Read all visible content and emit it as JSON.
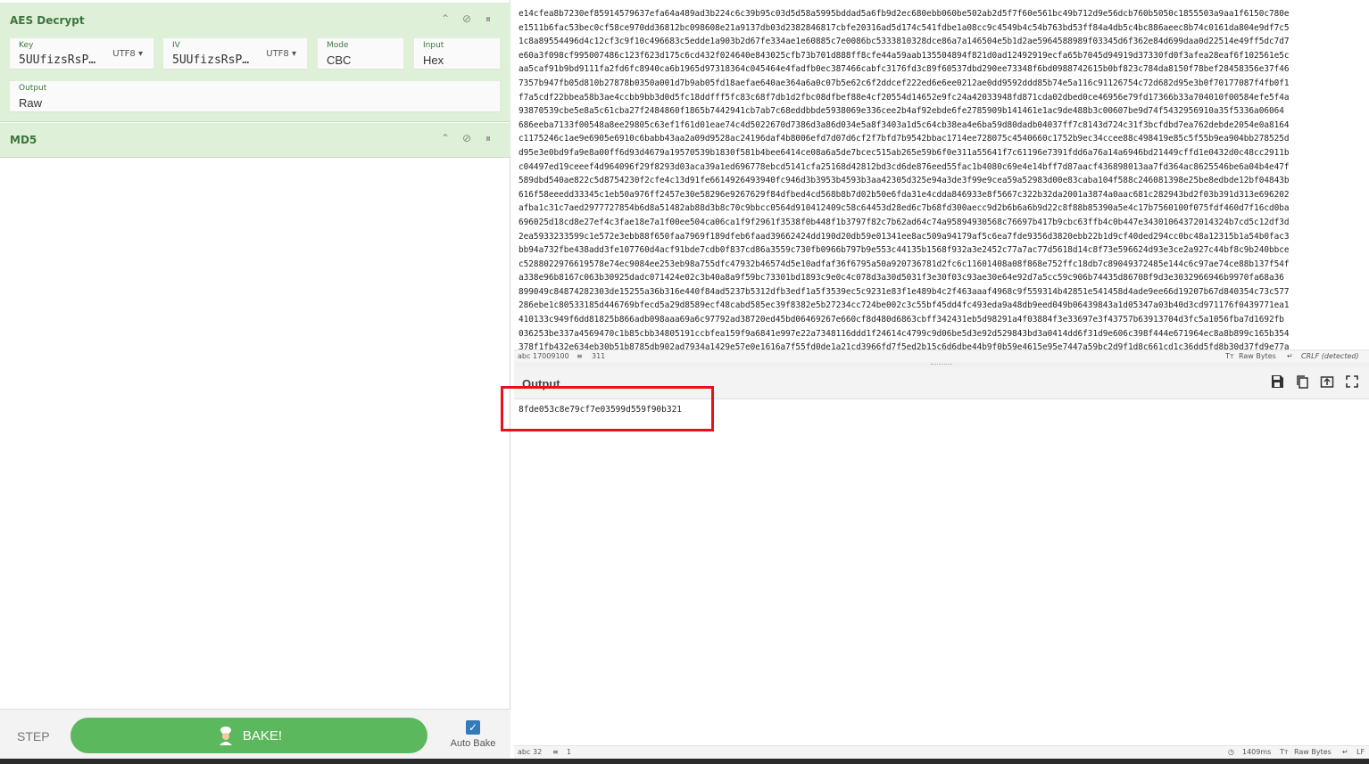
{
  "recipe": {
    "aes": {
      "title": "AES Decrypt",
      "key_label": "Key",
      "key_value": "5UUfizsRsP…",
      "key_encoding": "UTF8",
      "iv_label": "IV",
      "iv_value": "5UUfizsRsP…",
      "iv_encoding": "UTF8",
      "mode_label": "Mode",
      "mode_value": "CBC",
      "input_label": "Input",
      "input_value": "Hex",
      "output_label": "Output",
      "output_value": "Raw"
    },
    "md5": {
      "title": "MD5"
    },
    "controls": {
      "step": "STEP",
      "bake": "BAKE!",
      "auto_bake": "Auto Bake"
    }
  },
  "input": {
    "lines": [
      "e14cfea8b7230ef85914579637efa64a489ad3b224c6c39b95c03d5d58a5995bddad5a6fb9d2ec680ebb060be502ab2d5f7f60e561bc49b712d9e56dcb760b5050c1855503a9aa1f6150c780e",
      "e1511b6fac53bec0cf58ce970dd36812bc098608e21a9137db03d2382846817cbfe20316ad5d174c541fdbe1a08cc9c4549b4c54b763bd53ff84a4db5c4bc886aeec8b74c0161da804e9df7c5",
      "1c8a89554496d4c12cf3c9f10c496683c5edde1a903b2d67fe334ae1e60885c7e0086bc5333810328dce86a7a146504e5b1d2ae5964588989f03345d6f362e84d699daa0d22514e49ff5dc7d7",
      "e60a3f098cf995007486c123f623d175c6cd432f024640e843025cfb73b701d888ff8cfe44a59aab135504894f821d0ad12492919ecfa65b7045d94919d37330fd0f3afea28eaf6f102561e5c",
      "aa5caf91b9bd9111fa2fd6fc8940ca6b1965d97318364c045464e4fadfb0ec387466cabfc3176fd3c89f60537dbd290ee73348f6bd0988742615b0bf823c784da8150f78bef28458356e37f46",
      "7357b947fb05d810b27878b0350a001d7b9ab05fd18aefae640ae364a6a0c07b5e62c6f2ddcef222ed6e6ee0212ae0dd9592ddd85b74e5a116c91126754c72d682d95e3b0f70177087f4fb0f1",
      "f7a5cdf22bbea58b3ae4ccbb9bb3d0d5fc18ddfff5fc83c68f7db1d2fbc08dfbef88e4cf20554d14652e9fc24a42033948fd871cda02dbed0ce46956e79fd17366b33a704010f00584efe5f4a",
      "93870539cbe5e8a5c61cba27f2484860f1865b7442941cb7ab7c68eddbbde5938069e336cee2b4af92ebde6fe2785909b141461e1ac9de488b3c00607be9d74f5432956910a35f5336a06064",
      "686eeba7133f00548a8ee29805c63ef1f61d01eae74c4d5022670d7386d3a86d034e5a8f3403a1d5c64cb38ea4e6ba59d80dadb04037ff7c8143d724c31f3bcfdbd7ea762debde2054e0a8164",
      "c1175246c1ae9e6905e6910c6babb43aa2a09d9528ac24196daf4b8006efd7d07d6cf2f7bfd7b9542bbac1714ee728075c4540660c1752b9ec34ccee88c498419e85c5f55b9ea904bb278525d",
      "d95e3e0bd9fa9e8a00ff6d93d4679a19570539b1830f581b4bee6414ce08a6a5de7bcec515ab265e59b6f0e311a55641f7c61196e7391fdd6a76a14a6946bd21449cffd1e0432d0c48cc2911b",
      "c04497ed19ceeef4d964096f29f8293d03aca39a1ed696778ebcd5141cfa25168d42812bd3cd6de876eed55fac1b4080c69e4e14bff7d87aacf436898013aa7fd364ac8625546be6a04b4e47f",
      "589dbd540ae822c5d8754230f2cfe4c13d91fe6614926493940fc946d3b3953b4593b3aa42305d325e94a3de3f99e9cea59a52983d00e83caba104f588c246081398e25be8edbde12bf04843b",
      "616f58eeedd33345c1eb50a976ff2457e30e58296e9267629f84dfbed4cd568b8b7d02b50e6fda31e4cdda846933e8f5667c322b32da2001a3874a0aac681c282943bd2f03b391d313e696202",
      "afba1c31c7aed2977727854b6d8a51482ab88d3b8c70c9bbcc0564d910412409c58c64453d28ed6c7b68fd300aecc9d2b6b6a6b9d22c8f88b85390a5e4c17b7560100f075fdf460d7f16cd0ba",
      "696025d18cd8e27ef4c3fae18e7a1f00ee504ca06ca1f9f2961f3538f0b448f1b3797f82c7b62ad64c74a95894930568c76697b417b9cbc63ffb4c0b447e34301064372014324b7cd5c12df3d",
      "2ea5933233599c1e572e3ebb88f650faa7969f189dfeb6faad39662424dd190d20db59e01341ee8ac509a94179af5c6ea7fde9356d3820ebb22b1d9cf40ded294cc0bc48a12315b1a54b0fac3",
      "bb94a732fbe438add3fe107760d4acf91bde7cdb0f837cd86a3559c730fb0966b797b9e553c44135b1568f932a3e2452c77a7ac77d5618d14c8f73e596624d93e3ce2a927c44bf8c9b240bbce",
      "c5288022976619578e74ec9084ee253eb98a755dfc47932b46574d5e10adfaf36f6795a50a920736781d2fc6c11601408a08f868e752ffc18db7c89049372485e144c6c97ae74ce88b137f54f",
      "a338e96b8167c063b30925dadc071424e02c3b40a8a9f59bc73301bd1893c9e0c4c078d3a30d5031f3e30f03c93ae30e64e92d7a5cc59c906b74435d86708f9d3e3032966946b9970fa68a36",
      "899049c84874282303de15255a36b316e440f84ad5237b5312dfb3edf1a5f3539ec5c9231e83f1e489b4c2f463aaaf4968c9f559314b42851e541458d4ade9ee66d19207b67d840354c73c577",
      "286ebe1c80533185d446769bfecd5a29d8589ecf48cabd585ec39f8382e5b27234cc724be002c3c55bf45dd4fc493eda9a48db9eed049b06439843a1d05347a03b40d3cd971176f0439771ea1",
      "410133c949f6dd81825b866adb098aaa69a6c97792ad38720ed45bd06469267e660cf8d480d6863cbff342431eb5d98291a4f03884f3e33697e3f43757b63913704d3fc5a1056fba7d1692fb",
      "036253be337a4569470c1b85cbb34805191ccbfea159f9a6841e997e22a7348116ddd1f24614c4799c9d06be5d3e92d529843bd3a0414dd6f31d9e606c398f444e671964ec8a8b899c165b354",
      "378f1fb432e634eb30b51b8785db902ad7934a1429e57e0e1616a7f55fd0de1a21cd3966fd7f5ed2b15c6d6dbe44b9f0b59e4615e95e7447a59bc2d9f1d8c661cd1c36dd5fd8b30d37fd9e77a"
    ],
    "status": {
      "length": "17009100",
      "lines": "311",
      "raw_bytes": "Raw Bytes",
      "eol": "CRLF (detected)"
    }
  },
  "output": {
    "title": "Output",
    "text": "8fde053c8e79cf7e03599d559f90b321",
    "status": {
      "length": "32",
      "lines": "1",
      "time": "1409ms",
      "raw_bytes": "Raw Bytes",
      "eol": "LF"
    }
  }
}
